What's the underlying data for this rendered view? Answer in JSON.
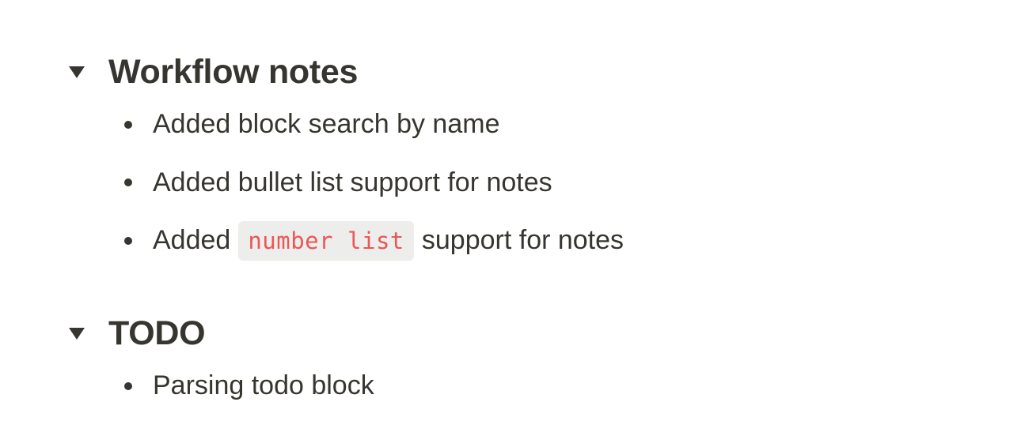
{
  "colors": {
    "text": "#37352f",
    "code_text": "#eb5757",
    "code_background": "#efefee",
    "background": "#ffffff"
  },
  "icons": {
    "toggle": "triangle-down-icon",
    "bullet": "bullet-dot-icon"
  },
  "blocks": [
    {
      "title": "Workflow notes",
      "expanded": true,
      "items": [
        {
          "text": "Added block search by name"
        },
        {
          "text": "Added bullet list support for notes"
        },
        {
          "prefix": "Added",
          "code": "number list",
          "suffix": "support for notes"
        }
      ]
    },
    {
      "title": "TODO",
      "expanded": true,
      "items": [
        {
          "text": "Parsing todo block"
        }
      ]
    }
  ]
}
